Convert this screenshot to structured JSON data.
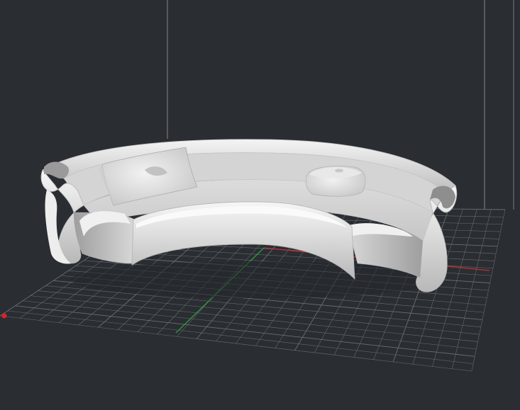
{
  "viewport": {
    "background": "#2a2e32",
    "grid_color": "#6a6e72",
    "x_axis_color": "#c0303a",
    "y_axis_color": "#2e9a3c",
    "model_color": "#e6e6e6",
    "origin_marker_color": "#e0202a"
  },
  "model": {
    "name": "curved-sofa"
  }
}
